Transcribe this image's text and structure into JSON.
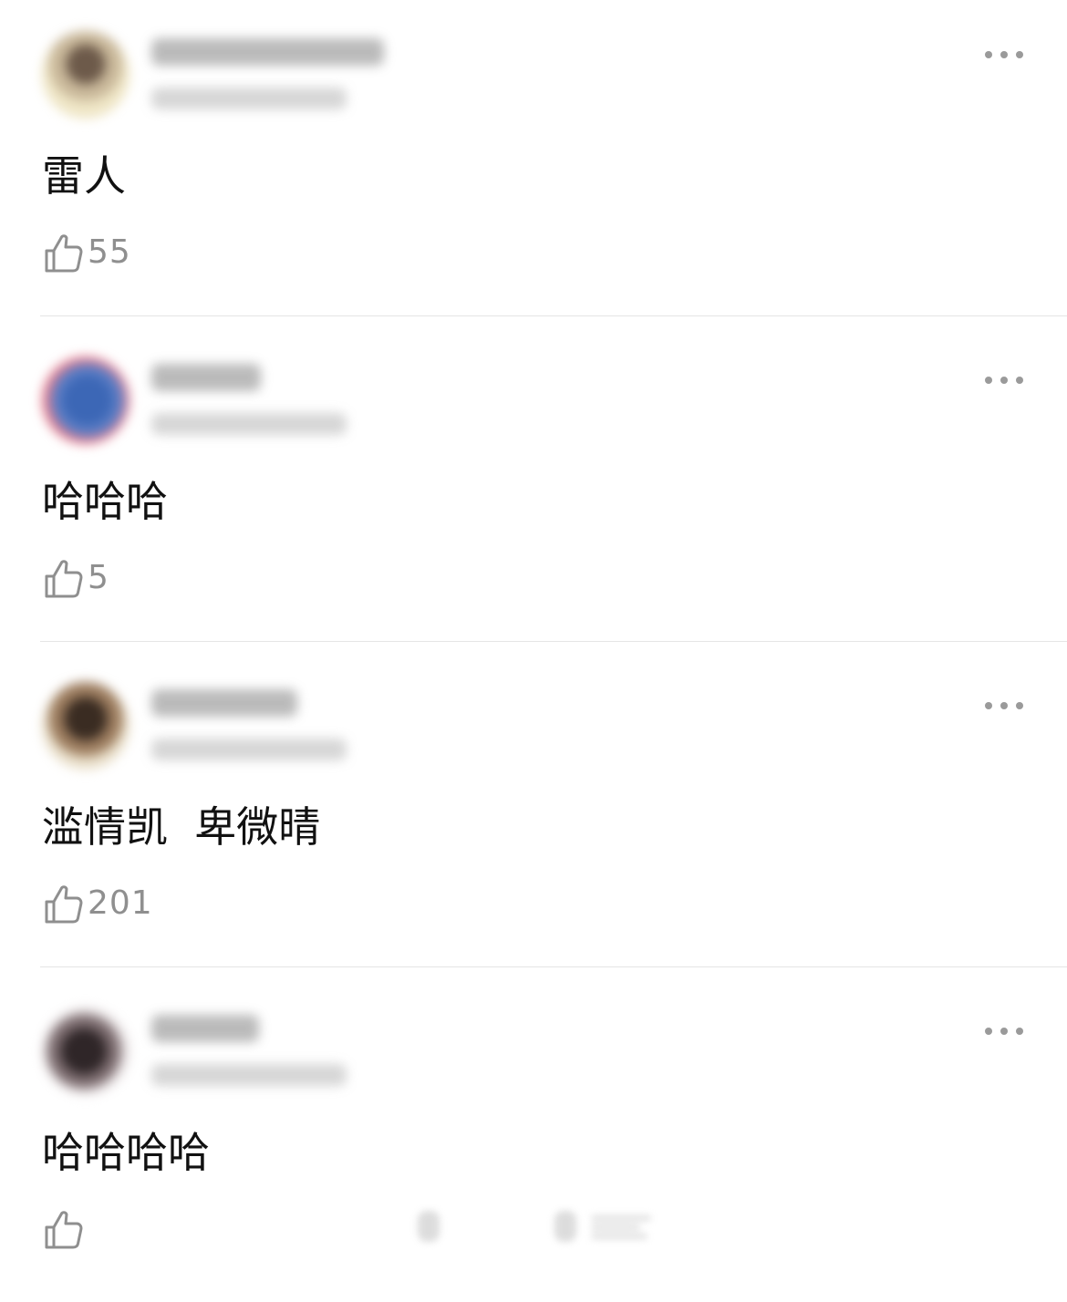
{
  "comments": [
    {
      "text": "雷人",
      "likes": "55"
    },
    {
      "text": "哈哈哈",
      "likes": "5"
    },
    {
      "text": "滥情凯  卑微晴",
      "likes": "201"
    },
    {
      "text": "哈哈哈哈",
      "likes": ""
    }
  ],
  "icons": {
    "more": "more-icon",
    "like": "thumb-up-icon"
  },
  "colors": {
    "text": "#111111",
    "secondary": "#8f8f8f",
    "icon": "#9a9a9a",
    "divider": "#e5e5e5"
  }
}
